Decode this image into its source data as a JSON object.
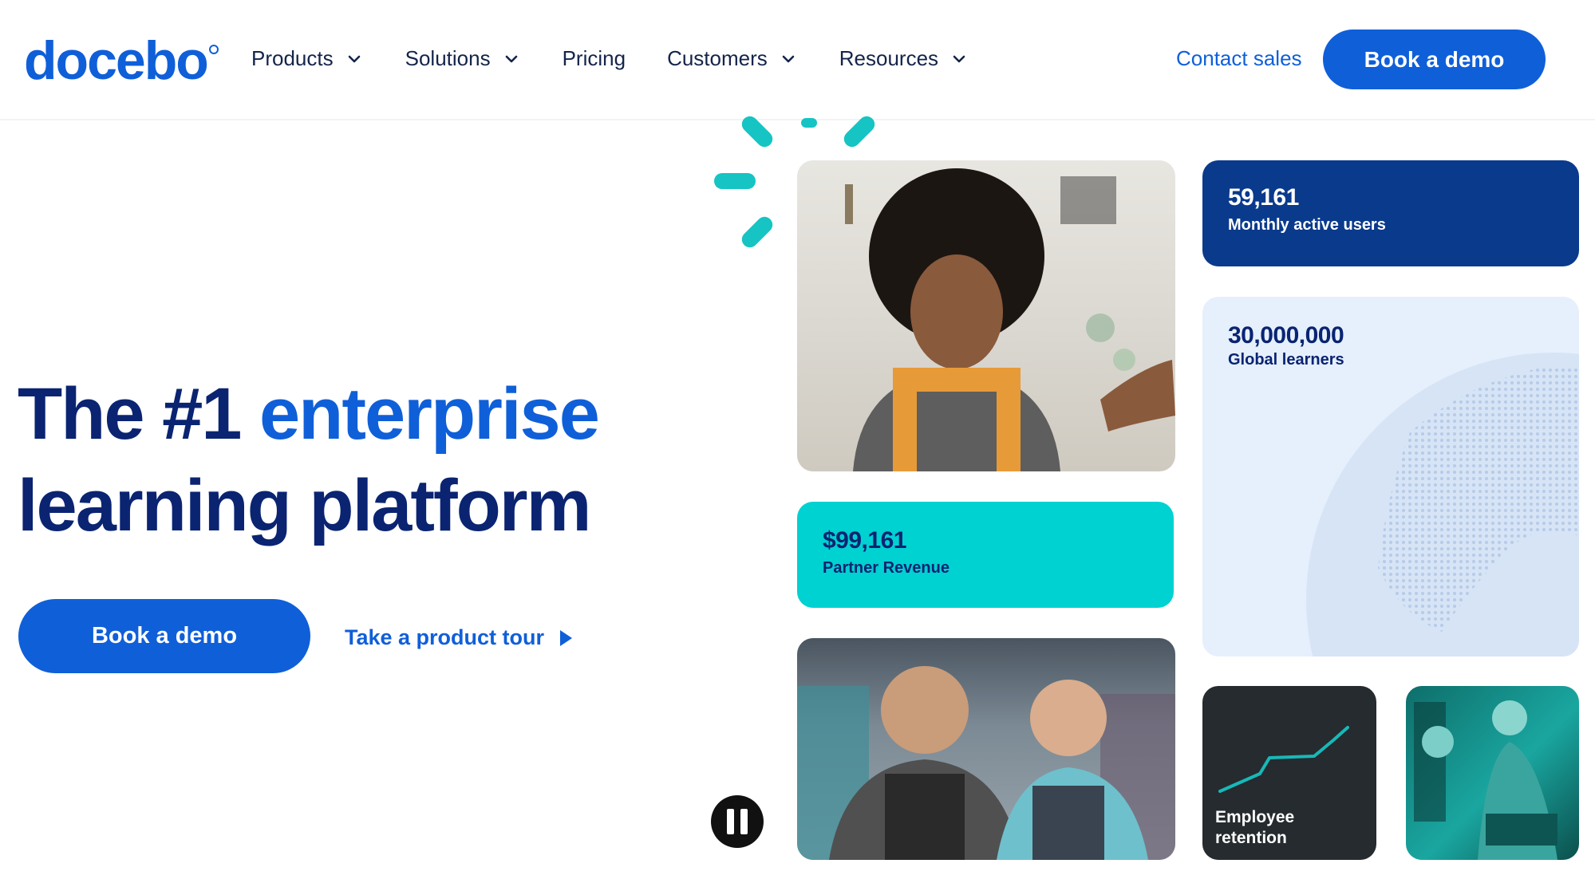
{
  "brand": {
    "logo_text": "docebo",
    "accent": "#0f5fd9",
    "navy": "#0a2472",
    "teal": "#00d1d1"
  },
  "nav": {
    "items": [
      {
        "label": "Products",
        "has_dropdown": true
      },
      {
        "label": "Solutions",
        "has_dropdown": true
      },
      {
        "label": "Pricing",
        "has_dropdown": false
      },
      {
        "label": "Customers",
        "has_dropdown": true
      },
      {
        "label": "Resources",
        "has_dropdown": true
      }
    ],
    "contact_label": "Contact sales",
    "cta_label": "Book a demo"
  },
  "hero": {
    "title_part1": "The #1 ",
    "title_accent": "enterprise",
    "title_part2": "learning platform",
    "cta_label": "Book a demo",
    "tour_label": "Take a product tour"
  },
  "stats": {
    "monthly": {
      "value": "59,161",
      "label": "Monthly active users"
    },
    "global": {
      "value": "30,000,000",
      "label": "Global learners"
    },
    "partner": {
      "value": "$99,161",
      "label": "Partner Revenue"
    },
    "retention": {
      "label_line1": "Employee",
      "label_line2": "retention"
    }
  }
}
